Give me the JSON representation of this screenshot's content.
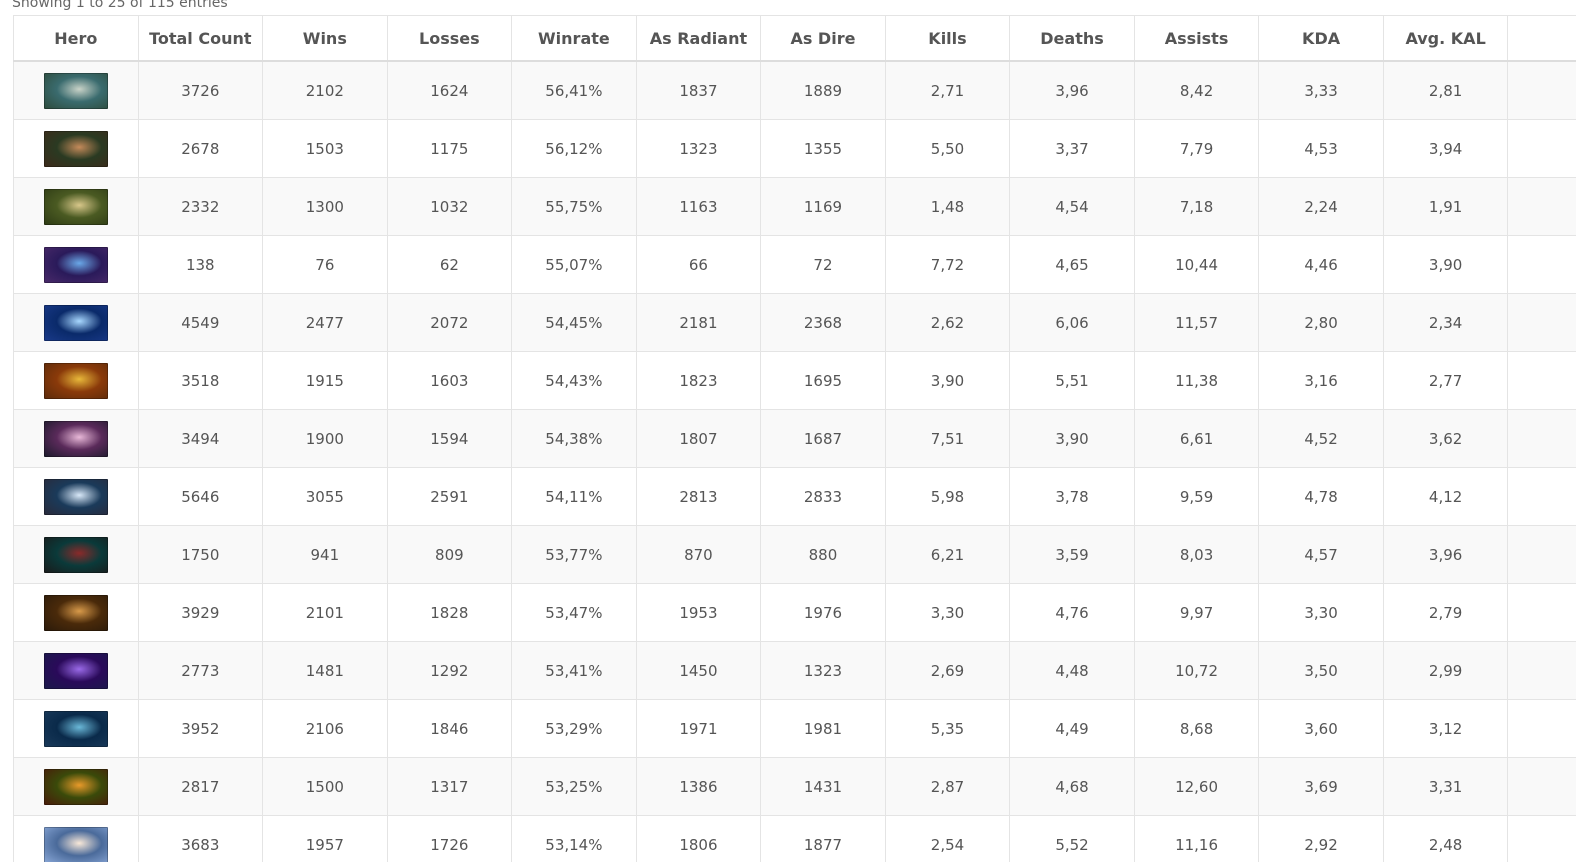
{
  "info_text": "Showing 1 to 25 of 115 entries",
  "columns": [
    "Hero",
    "Total Count",
    "Wins",
    "Losses",
    "Winrate",
    "As Radiant",
    "As Dire",
    "Kills",
    "Deaths",
    "Assists",
    "KDA",
    "Avg. KAL",
    ""
  ],
  "rows": [
    {
      "icon": "hero-portrait-1",
      "colors": [
        "#3a6b6e",
        "#c9d3c8",
        "#2d4a3a"
      ],
      "cells": [
        "3726",
        "2102",
        "1624",
        "56,41%",
        "1837",
        "1889",
        "2,71",
        "3,96",
        "8,42",
        "3,33",
        "2,81"
      ]
    },
    {
      "icon": "hero-portrait-2",
      "colors": [
        "#2a3a22",
        "#c48a5a",
        "#3d2a1a"
      ],
      "cells": [
        "2678",
        "1503",
        "1175",
        "56,12%",
        "1323",
        "1355",
        "5,50",
        "3,37",
        "7,79",
        "4,53",
        "3,94"
      ]
    },
    {
      "icon": "hero-portrait-3",
      "colors": [
        "#4a5a22",
        "#d8c78a",
        "#2d3a14"
      ],
      "cells": [
        "2332",
        "1300",
        "1032",
        "55,75%",
        "1163",
        "1169",
        "1,48",
        "4,54",
        "7,18",
        "2,24",
        "1,91"
      ]
    },
    {
      "icon": "hero-portrait-4",
      "colors": [
        "#2a1a5a",
        "#6aa8e8",
        "#4a2a6a"
      ],
      "cells": [
        "138",
        "76",
        "62",
        "55,07%",
        "66",
        "72",
        "7,72",
        "4,65",
        "10,44",
        "4,46",
        "3,90"
      ]
    },
    {
      "icon": "hero-portrait-5",
      "colors": [
        "#0a2a6a",
        "#a8d8ff",
        "#1a3a8a"
      ],
      "cells": [
        "4549",
        "2477",
        "2072",
        "54,45%",
        "2181",
        "2368",
        "2,62",
        "6,06",
        "11,57",
        "2,80",
        "2,34"
      ]
    },
    {
      "icon": "hero-portrait-6",
      "colors": [
        "#8a3a0a",
        "#e8b83a",
        "#5a2a0a"
      ],
      "cells": [
        "3518",
        "1915",
        "1603",
        "54,43%",
        "1823",
        "1695",
        "3,90",
        "5,51",
        "11,38",
        "3,16",
        "2,77"
      ]
    },
    {
      "icon": "hero-portrait-7",
      "colors": [
        "#5a2a5a",
        "#e8b8d8",
        "#1a1a2a"
      ],
      "cells": [
        "3494",
        "1900",
        "1594",
        "54,38%",
        "1807",
        "1687",
        "7,51",
        "3,90",
        "6,61",
        "4,52",
        "3,62"
      ]
    },
    {
      "icon": "hero-portrait-8",
      "colors": [
        "#1a3a5a",
        "#d8e8f8",
        "#2a2a3a"
      ],
      "cells": [
        "5646",
        "3055",
        "2591",
        "54,11%",
        "2813",
        "2833",
        "5,98",
        "3,78",
        "9,59",
        "4,78",
        "4,12"
      ]
    },
    {
      "icon": "hero-portrait-9",
      "colors": [
        "#0a3a3a",
        "#8a2a2a",
        "#1a1a1a"
      ],
      "cells": [
        "1750",
        "941",
        "809",
        "53,77%",
        "870",
        "880",
        "6,21",
        "3,59",
        "8,03",
        "4,57",
        "3,96"
      ]
    },
    {
      "icon": "hero-portrait-10",
      "colors": [
        "#4a2a0a",
        "#d89a4a",
        "#2a1a0a"
      ],
      "cells": [
        "3929",
        "2101",
        "1828",
        "53,47%",
        "1953",
        "1976",
        "3,30",
        "4,76",
        "9,97",
        "3,30",
        "2,79"
      ]
    },
    {
      "icon": "hero-portrait-11",
      "colors": [
        "#2a0a5a",
        "#9a6ae8",
        "#1a1a4a"
      ],
      "cells": [
        "2773",
        "1481",
        "1292",
        "53,41%",
        "1450",
        "1323",
        "2,69",
        "4,48",
        "10,72",
        "3,50",
        "2,99"
      ]
    },
    {
      "icon": "hero-portrait-12",
      "colors": [
        "#0a2a4a",
        "#6ab8d8",
        "#1a3a5a"
      ],
      "cells": [
        "3952",
        "2106",
        "1846",
        "53,29%",
        "1971",
        "1981",
        "5,35",
        "4,49",
        "8,68",
        "3,60",
        "3,12"
      ]
    },
    {
      "icon": "hero-portrait-13",
      "colors": [
        "#3a4a0a",
        "#e89a2a",
        "#4a1a0a"
      ],
      "cells": [
        "2817",
        "1500",
        "1317",
        "53,25%",
        "1386",
        "1431",
        "2,87",
        "4,68",
        "12,60",
        "3,69",
        "3,31"
      ]
    },
    {
      "icon": "hero-portrait-14",
      "colors": [
        "#4a6a9a",
        "#f8e8d8",
        "#8aa8d8"
      ],
      "cells": [
        "3683",
        "1957",
        "1726",
        "53,14%",
        "1806",
        "1877",
        "2,54",
        "5,52",
        "11,16",
        "2,92",
        "2,48"
      ]
    }
  ]
}
